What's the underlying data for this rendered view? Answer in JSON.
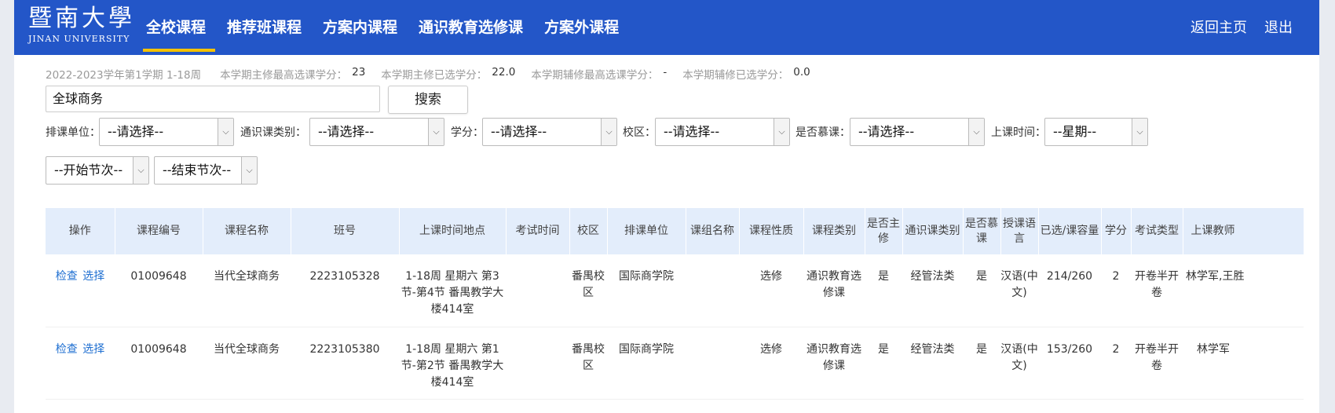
{
  "header": {
    "logo_cn": "暨南大學",
    "logo_en": "JINAN UNIVERSITY",
    "nav": [
      "全校课程",
      "推荐班课程",
      "方案内课程",
      "通识教育选修课",
      "方案外课程"
    ],
    "links": [
      "返回主页",
      "退出"
    ],
    "color": "#2356c8",
    "accent": "#f5c200"
  },
  "info": {
    "term": "2022-2023学年第1学期 1-18周",
    "max_major_label": "本学期主修最高选课学分：",
    "max_major_value": "23",
    "chosen_major_label": "本学期主修已选学分：",
    "chosen_major_value": "22.0",
    "max_minor_label": "本学期辅修最高选课学分：",
    "max_minor_value": "-",
    "chosen_minor_label": "本学期辅修已选学分：",
    "chosen_minor_value": "0.0"
  },
  "search": {
    "value": "全球商务",
    "button": "搜索"
  },
  "filters": {
    "dept_label": "排课单位：",
    "dept_value": "--请选择--",
    "category_label": "通识课类别：",
    "category_value": "--请选择--",
    "credit_label": "学分：",
    "credit_value": "--请选择--",
    "campus_label": "校区：",
    "campus_value": "--请选择--",
    "mooc_label": "是否慕课：",
    "mooc_value": "--请选择--",
    "time_label": "上课时间：",
    "time_value": "--星期--",
    "start_value": "--开始节次--",
    "end_value": "--结束节次--",
    "arrow": "chevron-down-icon"
  },
  "table": {
    "headers": [
      "操作",
      "课程编号",
      "课程名称",
      "班号",
      "上课时间地点",
      "考试时间",
      "校区",
      "排课单位",
      "课组名称",
      "课程性质",
      "课程类别",
      "是否主修",
      "通识课类别",
      "是否慕课",
      "授课语言",
      "已选/课容量",
      "学分",
      "考试类型",
      "上课教师"
    ],
    "rows": [
      {
        "op_view": "检查",
        "op_select": "选择",
        "code": "01009648",
        "name": "当代全球商务",
        "class_no": "2223105328",
        "time_place": "1-18周 星期六 第3节-第4节 番禺教学大楼414室",
        "exam_time": "",
        "campus": "番禺校区",
        "dept": "国际商学院",
        "group": "",
        "nature": "选修",
        "category": "通识教育选修课",
        "major": "是",
        "gen_category": "经管法类",
        "mooc": "是",
        "lang": "汉语(中文)",
        "capacity": "214/260",
        "credit": "2",
        "exam_type": "开卷半开卷",
        "teacher": "林学军,王胜"
      },
      {
        "op_view": "检查",
        "op_select": "选择",
        "code": "01009648",
        "name": "当代全球商务",
        "class_no": "2223105380",
        "time_place": "1-18周 星期六 第1节-第2节 番禺教学大楼414室",
        "exam_time": "",
        "campus": "番禺校区",
        "dept": "国际商学院",
        "group": "",
        "nature": "选修",
        "category": "通识教育选修课",
        "major": "是",
        "gen_category": "经管法类",
        "mooc": "是",
        "lang": "汉语(中文)",
        "capacity": "153/260",
        "credit": "2",
        "exam_type": "开卷半开卷",
        "teacher": "林学军"
      }
    ]
  }
}
